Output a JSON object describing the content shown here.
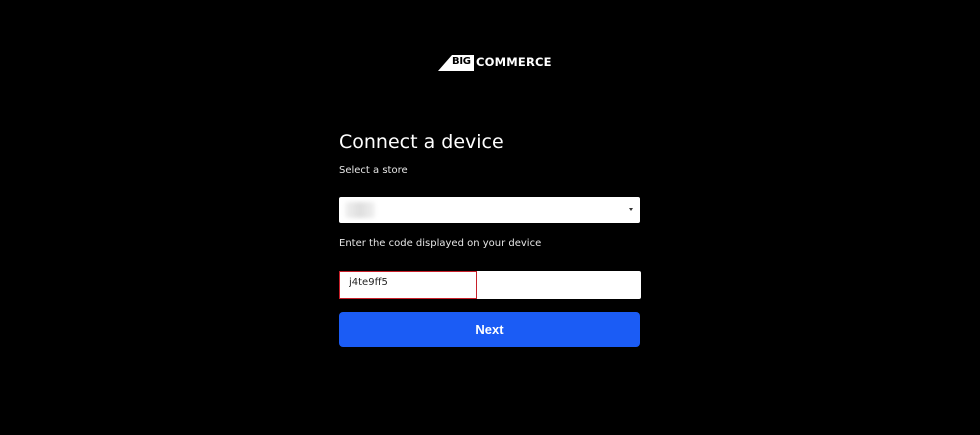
{
  "logo": {
    "big_text": "BIG",
    "commerce_text": "COMMERCE"
  },
  "page": {
    "title": "Connect a device"
  },
  "store_select": {
    "label": "Select a store",
    "selected_value": ""
  },
  "code_field": {
    "label": "Enter the code displayed on your device",
    "value": "j4te9ff5"
  },
  "next_button": {
    "label": "Next"
  },
  "colors": {
    "background": "#000000",
    "button": "#1b5cf5",
    "highlight_border": "#c8202a"
  },
  "icons": {
    "select_arrow": "chevron-down-icon",
    "logo_mark": "bigcommerce-logo-icon"
  }
}
